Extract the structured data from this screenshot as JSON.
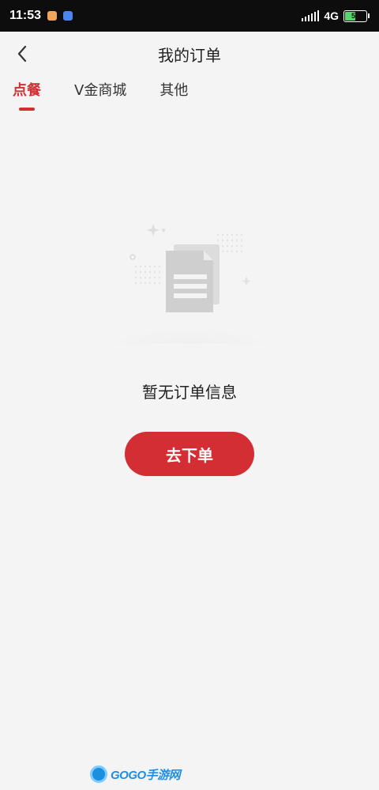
{
  "status_bar": {
    "time": "11:53",
    "network": "4G",
    "battery": "51"
  },
  "header": {
    "title": "我的订单"
  },
  "tabs": [
    {
      "label": "点餐",
      "active": true
    },
    {
      "label": "V金商城",
      "active": false
    },
    {
      "label": "其他",
      "active": false
    }
  ],
  "empty_state": {
    "message": "暂无订单信息",
    "button_label": "去下单"
  },
  "watermark": {
    "text": "GOGO手游网"
  },
  "colors": {
    "accent": "#d42e35",
    "background": "#f4f4f4"
  },
  "icons": {
    "back": "chevron-left-icon",
    "empty": "document-icon"
  }
}
